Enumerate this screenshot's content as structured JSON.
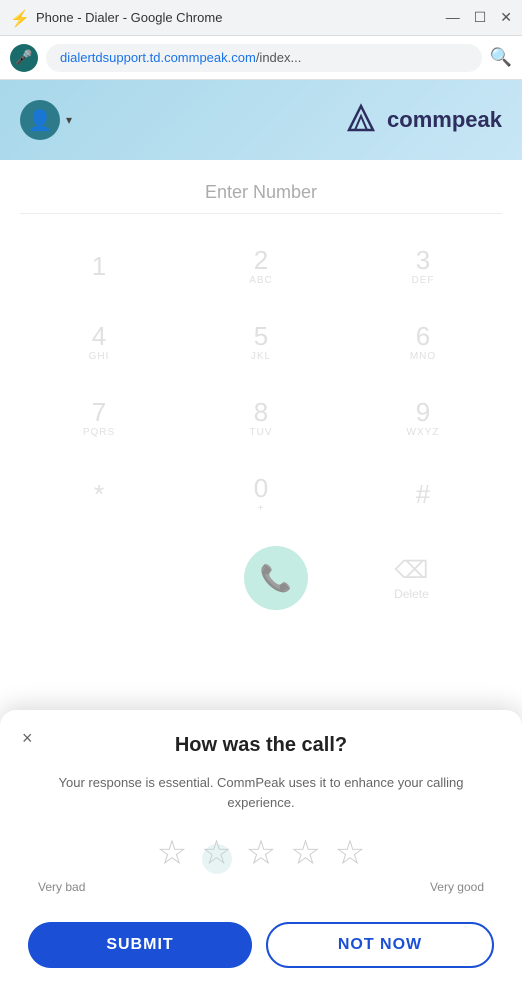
{
  "titleBar": {
    "icon": "⚡",
    "title": "Phone - Dialer - Google Chrome",
    "minimize": "—",
    "maximize": "☐",
    "close": "✕"
  },
  "addressBar": {
    "micIcon": "🎤",
    "url": "dialertdsupport.td.commpeak.com/index...",
    "urlHighlight": "dialertdsupport.td.commpeak.com",
    "urlSuffix": "/index...",
    "searchIcon": "🔍"
  },
  "appHeader": {
    "logoText": "commpeak",
    "avatarIcon": "👤",
    "chevron": "▾"
  },
  "dialer": {
    "placeholder": "Enter Number",
    "keys": [
      {
        "number": "1",
        "letters": ""
      },
      {
        "number": "2",
        "letters": "ABC"
      },
      {
        "number": "3",
        "letters": "DEF"
      },
      {
        "number": "4",
        "letters": "GHI"
      },
      {
        "number": "5",
        "letters": "JKL"
      },
      {
        "number": "6",
        "letters": "MNO"
      },
      {
        "number": "7",
        "letters": "PQRS"
      },
      {
        "number": "8",
        "letters": "TUV"
      },
      {
        "number": "9",
        "letters": "WXYZ"
      },
      {
        "number": "*",
        "letters": ""
      },
      {
        "number": "0",
        "letters": "+"
      },
      {
        "number": "#",
        "letters": ""
      }
    ],
    "deleteLabel": "Delete",
    "callIcon": "📞"
  },
  "modal": {
    "closeIcon": "×",
    "title": "How was the call?",
    "description": "Your response is essential. CommPeak uses it to enhance your calling experience.",
    "stars": [
      {
        "label": "star-1"
      },
      {
        "label": "star-2"
      },
      {
        "label": "star-3"
      },
      {
        "label": "star-4"
      },
      {
        "label": "star-5"
      }
    ],
    "veryBadLabel": "Very bad",
    "veryGoodLabel": "Very good",
    "submitLabel": "SUBMIT",
    "notNowLabel": "NOT NOW"
  },
  "colors": {
    "primary": "#1a4fd6",
    "callButton": "#a0e0d0",
    "headerBg": "#b8dff0"
  }
}
